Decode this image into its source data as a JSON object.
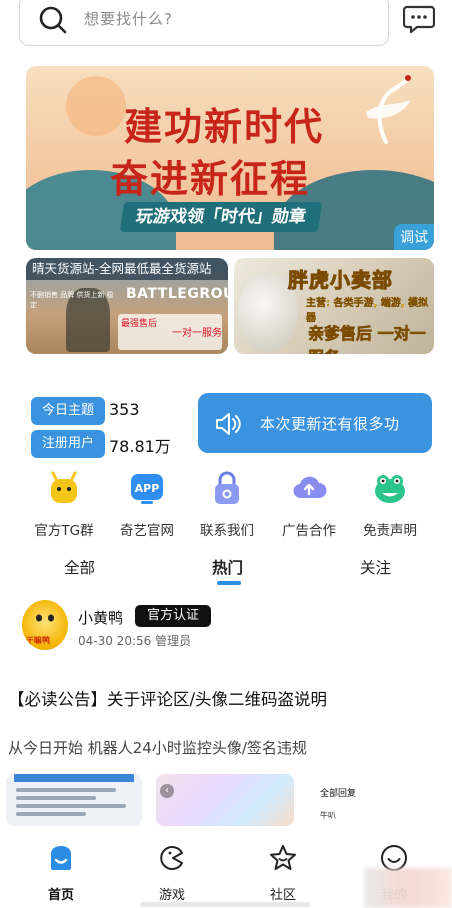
{
  "search": {
    "placeholder": "想要找什么?"
  },
  "banner": {
    "line1": "建功新时代",
    "line2": "奋进新征程",
    "ribbon": "玩游戏领「时代」勋章",
    "tag": "调试"
  },
  "ads": {
    "left": {
      "title": "晴天货源站-全网最低最全货源站",
      "logo": "BATTLEGROUNDS",
      "small_text": "不删销售 品牌 供货上新 稳定",
      "red1": "最强售后",
      "red2": "一对一服务"
    },
    "right": {
      "title": "胖虎小卖部",
      "subtitle": "主营: 各类手游, 端游, 模拟器",
      "service": "亲爹售后 一对一服务"
    }
  },
  "stats": {
    "topics_label": "今日主题",
    "topics_value": "353",
    "users_label": "注册用户",
    "users_value": "78.81万"
  },
  "notice": {
    "text": "本次更新还有很多功"
  },
  "quick_links": [
    {
      "label": "官方TG群",
      "icon": "robot-icon",
      "color": "#f5c518"
    },
    {
      "label": "奇艺官网",
      "icon": "app-icon",
      "color": "#2f8ef0"
    },
    {
      "label": "联系我们",
      "icon": "lock-icon",
      "color": "#7d8fe8"
    },
    {
      "label": "广告合作",
      "icon": "cloud-upload-icon",
      "color": "#8a8df0"
    },
    {
      "label": "免责声明",
      "icon": "frog-icon",
      "color": "#2bc48a"
    }
  ],
  "feed_tabs": [
    {
      "label": "全部"
    },
    {
      "label": "热门"
    },
    {
      "label": "关注"
    }
  ],
  "post": {
    "username": "小黄鸭",
    "badge": "官方认证",
    "meta": "04-30 20:56 管理员",
    "avatar_tag": "干嘛鸭",
    "title": "【必读公告】关于评论区/头像二维码盗说明",
    "excerpt": "从今日开始 机器人24小时监控头像/签名违规",
    "thumb3_head": "全部回复",
    "thumb3_row": "牛叭"
  },
  "tabbar": [
    {
      "label": "首页",
      "icon": "home-icon"
    },
    {
      "label": "游戏",
      "icon": "game-icon"
    },
    {
      "label": "社区",
      "icon": "star-icon"
    },
    {
      "label": "我的",
      "icon": "smile-icon"
    }
  ],
  "colors": {
    "accent": "#3b93e0",
    "indicator": "#2b8de3"
  }
}
